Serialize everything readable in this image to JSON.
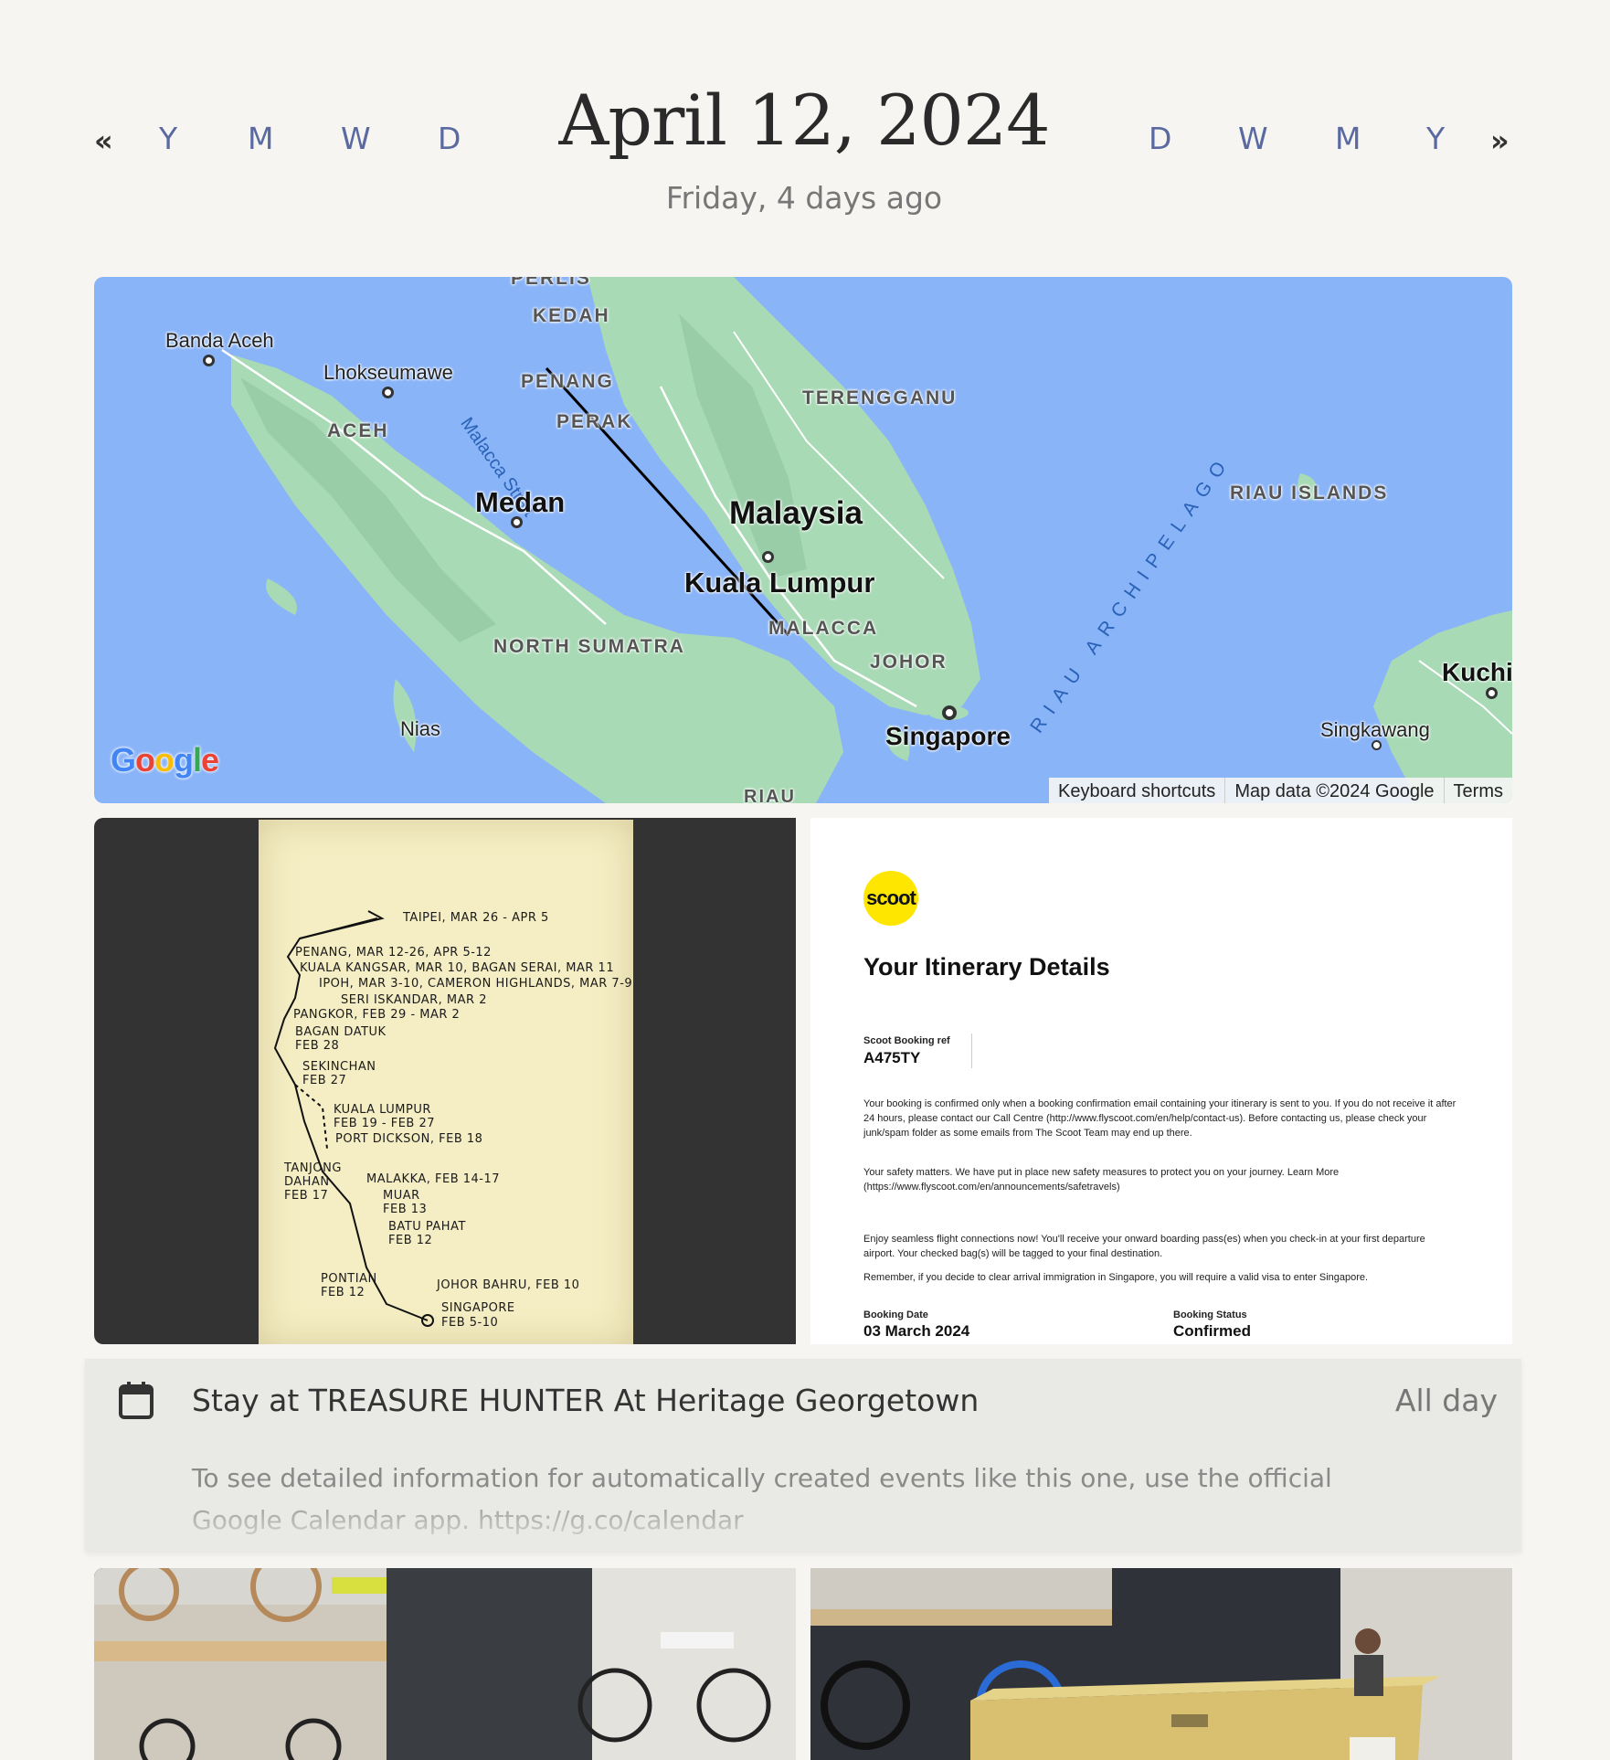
{
  "header": {
    "title": "April 12, 2024",
    "subtitle": "Friday, 4 days ago",
    "nav_prev_arrow": "«",
    "nav_next_arrow": "»",
    "nav_prev": [
      "Y",
      "M",
      "W",
      "D"
    ],
    "nav_next": [
      "D",
      "W",
      "M",
      "Y"
    ]
  },
  "map": {
    "labels": {
      "perlis": "PERLIS",
      "kedah": "KEDAH",
      "banda_aceh": "Banda Aceh",
      "lhokseumawe": "Lhokseumawe",
      "malacca_strait": "Malacca Strait",
      "penang": "PENANG",
      "terengganu": "TERENGGANU",
      "perak": "PERAK",
      "aceh": "ACEH",
      "riau_islands": "RIAU ISLANDS",
      "medan": "Medan",
      "malaysia": "Malaysia",
      "kuala_lumpur": "Kuala Lumpur",
      "riau_archipelago": "RIAU ARCHIPELAGO",
      "north_sumatra": "NORTH SUMATRA",
      "malacca": "MALACCA",
      "johor": "JOHOR",
      "kuching": "Kuchin",
      "nias": "Nias",
      "singapore": "Singapore",
      "singkawang": "Singkawang",
      "riau": "RIAU"
    },
    "google_logo": "Google",
    "footer": {
      "shortcuts": "Keyboard shortcuts",
      "data": "Map data ©2024 Google",
      "terms": "Terms"
    },
    "route_line": "#000000",
    "water_color": "#8ab4f8",
    "land_color": "#a8dab5"
  },
  "notebook": {
    "entries": [
      "TAIPEI, MAR 26 - APR 5",
      "PENANG, MAR 12-26, APR 5-12",
      "KUALA KANGSAR, MAR 10, BAGAN SERAI, MAR 11",
      "IPOH, MAR 3-10, CAMERON HIGHLANDS, MAR 7-9",
      "SERI ISKANDAR, MAR 2",
      "PANGKOR, FEB 29 - MAR 2",
      "BAGAN DATUK",
      "FEB 28",
      "SEKINCHAN",
      "FEB 27",
      "KUALA LUMPUR",
      "FEB 19 - FEB 27",
      "PORT DICKSON, FEB 18",
      "TANJONG",
      "DAHAN",
      "FEB 17",
      "MALAKKA, FEB 14-17",
      "MUAR",
      "FEB 13",
      "BATU PAHAT",
      "FEB 12",
      "PONTIAN",
      "FEB 12",
      "JOHOR BAHRU, FEB 10",
      "SINGAPORE",
      "FEB 5-10"
    ]
  },
  "itinerary": {
    "logo": "scoot",
    "title": "Your Itinerary Details",
    "booking_ref_label": "Scoot Booking ref",
    "booking_ref": "A475TY",
    "para1": "Your booking is confirmed only when a booking confirmation email containing your itinerary is sent to you. If you do not receive it after 24 hours, please contact our Call Centre (http://www.flyscoot.com/en/help/contact-us). Before contacting us, please check your junk/spam folder as some emails from The Scoot Team may end up there.",
    "para2": "Your safety matters. We have put in place new safety measures to protect you on your journey. Learn More (https://www.flyscoot.com/en/announcements/safetravels)",
    "para3": "Enjoy seamless flight connections now! You'll receive your onward boarding pass(es) when you check-in at your first departure airport. Your checked bag(s) will be tagged to your final destination.",
    "para4": "Remember, if you decide to clear arrival immigration in Singapore, you will require a valid visa to enter Singapore.",
    "booking_date_label": "Booking Date",
    "booking_date": "03 March 2024",
    "booking_status_label": "Booking Status",
    "booking_status": "Confirmed"
  },
  "event": {
    "icon": "calendar-icon",
    "title": "Stay at TREASURE HUNTER At Heritage Georgetown",
    "time": "All day",
    "description": "To see detailed information for automatically created events like this one, use the official Google Calendar app. https://g.co/calendar"
  },
  "colors": {
    "background": "#f6f5f1",
    "nav_link": "#5a6aa0",
    "event_card": "#e9e9e5",
    "scoot_yellow": "#ffe600"
  }
}
